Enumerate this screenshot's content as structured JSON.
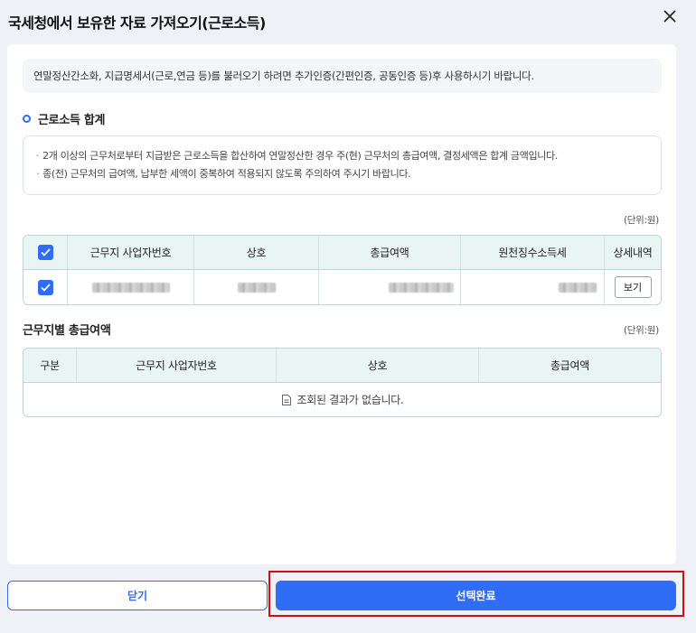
{
  "modal": {
    "title": "국세청에서 보유한 자료 가져오기(근로소득)"
  },
  "notice": "연말정산간소화, 지급명세서(근로,연금 등)를 불러오기 하려면 추가인증(간편인증, 공동인증 등)후 사용하시기 바랍니다.",
  "earned_income": {
    "title": "근로소득 합계",
    "info": [
      "2개 이상의 근무처로부터 지급받은 근로소득을 합산하여 연말정산한 경우 주(현) 근무처의 총급여액, 결정세액은 합계 금액입니다.",
      "종(전) 근무처의 급여액, 납부한 세액이 중복하여 적용되지 않도록 주의하여 주시기 바랍니다."
    ],
    "unit": "(단위:원)",
    "columns": [
      "근무지 사업자번호",
      "상호",
      "총급여액",
      "원천징수소득세",
      "상세내역"
    ],
    "rows": [
      {
        "checked": true,
        "view_label": "보기"
      }
    ],
    "header_checked": true
  },
  "by_workplace": {
    "title": "근무지별 총급여액",
    "unit": "(단위:원)",
    "columns": [
      "구분",
      "근무지 사업자번호",
      "상호",
      "총급여액"
    ],
    "empty_message": "조회된 결과가 없습니다."
  },
  "footer": {
    "close_label": "닫기",
    "complete_label": "선택완료"
  },
  "colors": {
    "primary": "#2f6df6",
    "table_header": "#e9f5f3",
    "highlight": "#d40c0c"
  }
}
